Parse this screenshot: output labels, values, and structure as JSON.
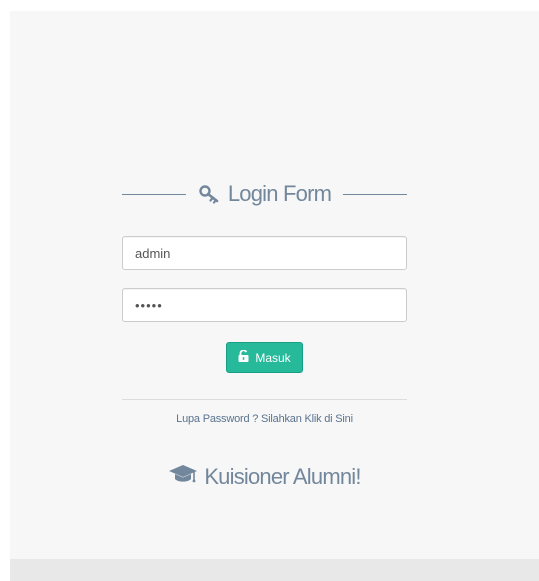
{
  "login_form": {
    "title": "Login Form",
    "title_icon": "key-icon",
    "username": {
      "value": "admin",
      "placeholder": ""
    },
    "password": {
      "value": "•••••",
      "placeholder": ""
    },
    "submit": {
      "label": "Masuk",
      "icon": "unlock-icon"
    },
    "forgot_link": "Lupa Password ? Silahkan Klik di Sini"
  },
  "brand": {
    "icon": "graduation-cap-icon",
    "name": "Kuisioner Alumni!"
  },
  "colors": {
    "accent": "#26b99a",
    "text_muted": "#73879c",
    "link": "#5a738e",
    "background": "#f7f7f7"
  }
}
